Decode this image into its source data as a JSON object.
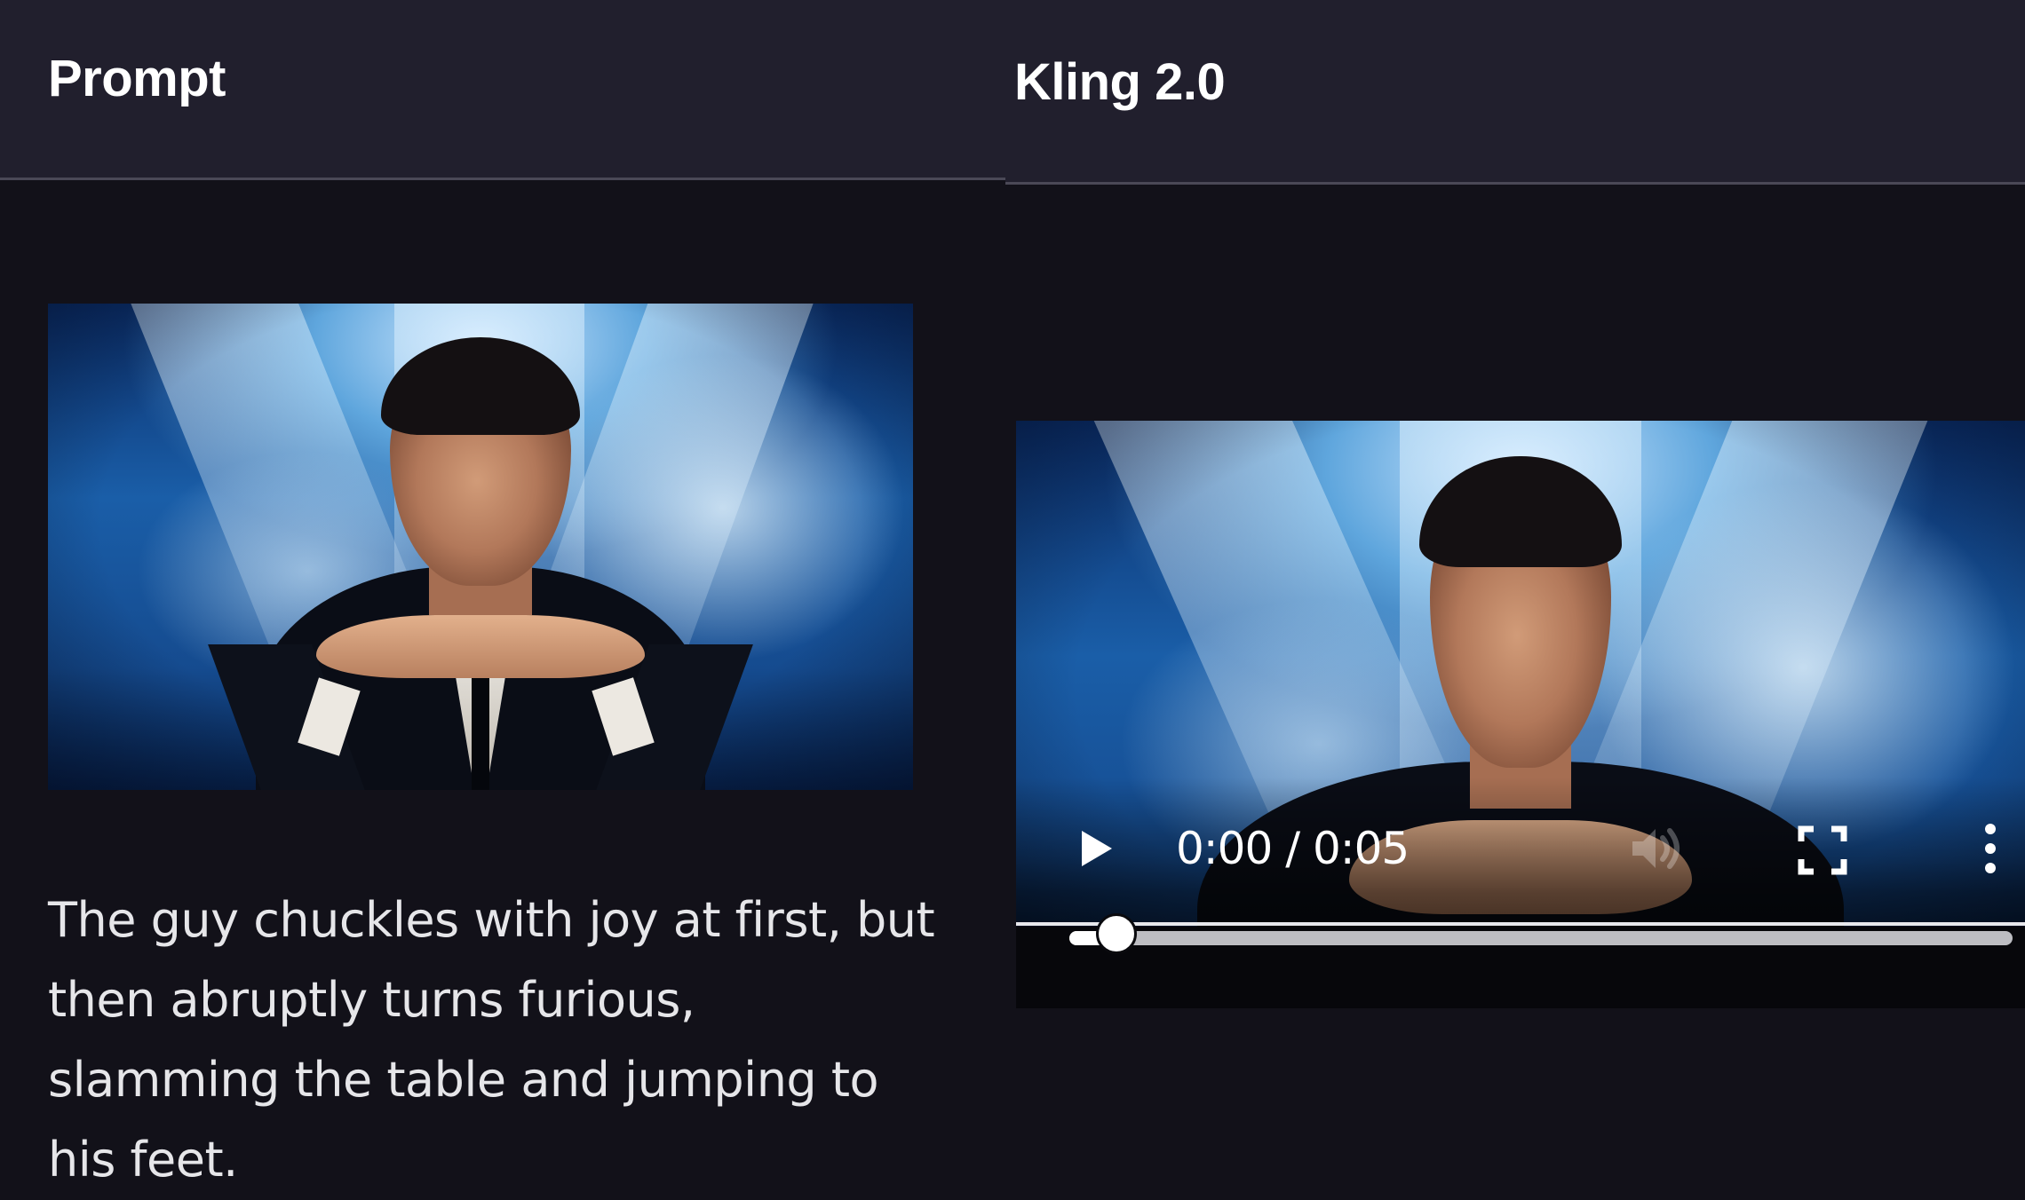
{
  "prompt_column": {
    "title": "Prompt",
    "image_icon": "prompt-image-man-hands-clasped",
    "text": "The guy chuckles with joy at first, but then abruptly turns furious, slamming the table and jumping to his feet."
  },
  "result_column": {
    "title": "Kling 2.0",
    "video": {
      "current_time": "0:00",
      "duration": "0:05",
      "time_display": "0:00 / 0:05",
      "progress_fraction": 0.05,
      "play_icon": "play-icon",
      "volume_icon": "volume-icon",
      "fullscreen_icon": "fullscreen-icon",
      "more_icon": "more-vertical-icon"
    }
  },
  "colors": {
    "background": "#121119",
    "header_background": "#211f2d",
    "header_border": "#4a4856",
    "text": "#e6e6e9"
  }
}
